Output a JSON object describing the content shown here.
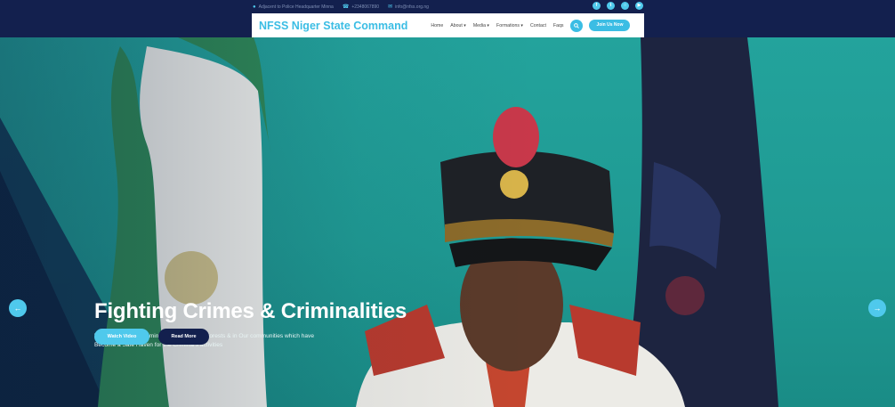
{
  "topbar": {
    "address": "Adjacent to Police Headquarter Minna",
    "phone": "+2348067890",
    "email": "info@nfss.org.ng",
    "social": [
      "facebook-icon",
      "twitter-icon",
      "instagram-icon",
      "youtube-icon"
    ]
  },
  "navbar": {
    "brand": "NFSS Niger State Command",
    "menu": [
      "Home",
      "About",
      "Media",
      "Formations",
      "Contact",
      "Faqs"
    ],
    "dropdown_flags": [
      false,
      true,
      true,
      true,
      false,
      false
    ],
    "join_label": "Join Us Now"
  },
  "hero": {
    "title": "Fighting Crimes & Criminalities",
    "text": "We Curb Crime & Criminalities in Nigeria's Forests & in Our communities which have Become a Safe Haven for the Criminal's activities",
    "watch_label": "Watch Video",
    "read_label": "Read More"
  },
  "colors": {
    "accent": "#4fc9ec",
    "navy": "#13204e",
    "teal_bg": "#23a39c"
  }
}
